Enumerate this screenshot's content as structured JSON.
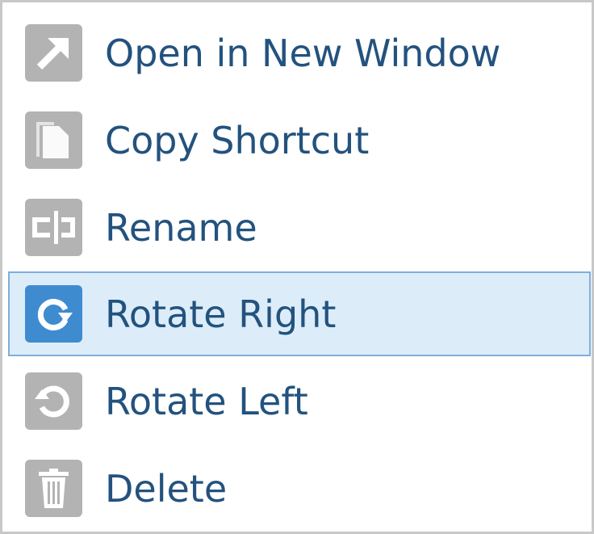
{
  "menu": {
    "items": [
      {
        "label": "Open in New Window",
        "icon": "open-new-window-icon",
        "selected": false
      },
      {
        "label": "Copy Shortcut",
        "icon": "copy-icon",
        "selected": false
      },
      {
        "label": "Rename",
        "icon": "rename-icon",
        "selected": false
      },
      {
        "label": "Rotate Right",
        "icon": "rotate-right-icon",
        "selected": true
      },
      {
        "label": "Rotate Left",
        "icon": "rotate-left-icon",
        "selected": false
      },
      {
        "label": "Delete",
        "icon": "trash-icon",
        "selected": false
      }
    ]
  },
  "colors": {
    "text": "#23527e",
    "icon_bg": "#b3b3b3",
    "selected_icon_bg": "#3f8bd0",
    "selected_row_bg": "#dcedf9",
    "selected_row_border": "#7eaedb",
    "menu_border": "#c8c8c8"
  }
}
